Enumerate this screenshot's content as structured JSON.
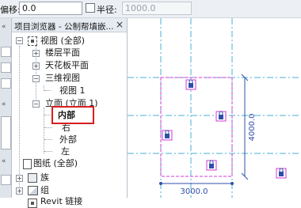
{
  "options_bar": {
    "offset_label": "偏移:",
    "offset_value": "0.0",
    "radius_label": "半径:",
    "radius_value": "1000.0",
    "radius_checked": false
  },
  "project_browser": {
    "title": "项目浏览器 - 公制帮填嵌...",
    "close_glyph": "×",
    "tree": {
      "views_root": "视图 (全部)",
      "floor_plans": "楼层平面",
      "ceiling_plans": "天花板平面",
      "three_d_views": "三维视图",
      "view_1": "视图 1",
      "elevations": "立面 (立面 1)",
      "elev_interior": "内部",
      "elev_right": "右",
      "elev_exterior": "外部",
      "elev_left": "左",
      "sheets": "图纸 (全部)",
      "families": "族",
      "groups": "组",
      "revit_links": "Revit 链接"
    }
  },
  "canvas": {
    "dimension_vertical": "4000.0",
    "dimension_horizontal": "3000.0",
    "accent_color": "#d23ad6",
    "ref_line_color": "#4ab0d4",
    "dim_color": "#2f4fa8"
  }
}
